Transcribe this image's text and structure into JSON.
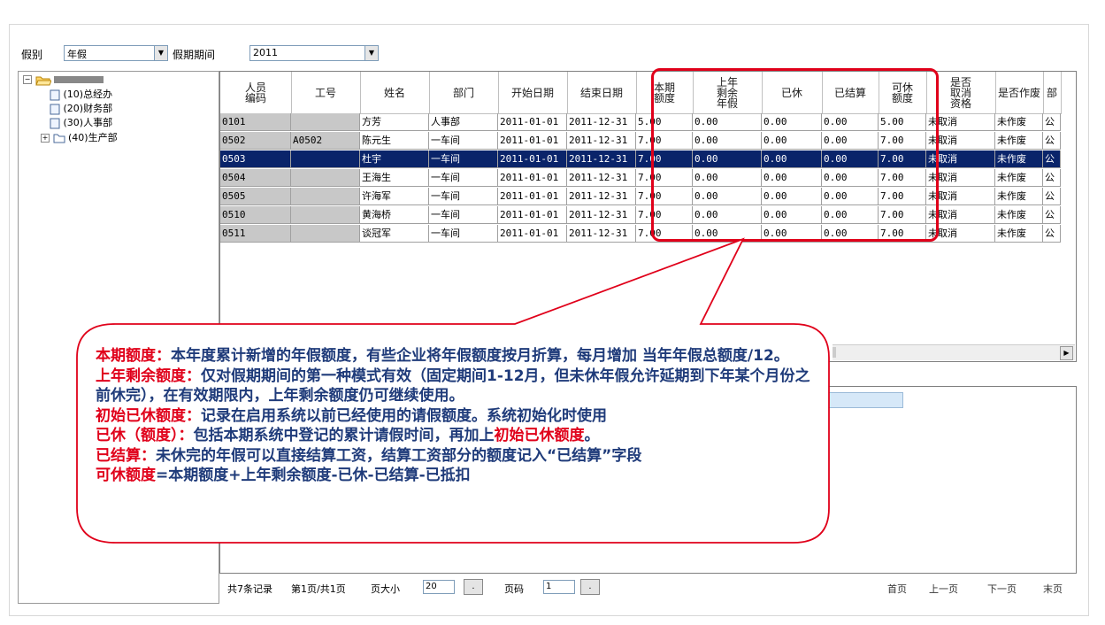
{
  "filters": {
    "leave_type_label": "假别",
    "leave_type_value": "年假",
    "period_label": "假期期间",
    "period_value": "2011"
  },
  "tree": {
    "root": "",
    "items": [
      {
        "label": "(10)总经办"
      },
      {
        "label": "(20)财务部"
      },
      {
        "label": "(30)人事部"
      },
      {
        "label": "(40)生产部"
      }
    ]
  },
  "grid": {
    "columns": [
      "人员编码",
      "工号",
      "姓名",
      "部门",
      "开始日期",
      "结束日期",
      "本期额度",
      "上年剩余年假",
      "已休",
      "已结算",
      "可休额度",
      "是否取消资格",
      "是否作废",
      "部"
    ],
    "rows": [
      [
        "0101",
        "",
        "方芳",
        "人事部",
        "2011-01-01",
        "2011-12-31",
        "5.00",
        "0.00",
        "0.00",
        "0.00",
        "5.00",
        "未取消",
        "未作废",
        "公"
      ],
      [
        "0502",
        "A0502",
        "陈元生",
        "一车间",
        "2011-01-01",
        "2011-12-31",
        "7.00",
        "0.00",
        "0.00",
        "0.00",
        "7.00",
        "未取消",
        "未作废",
        "公"
      ],
      [
        "0503",
        "",
        "杜宇",
        "一车间",
        "2011-01-01",
        "2011-12-31",
        "7.00",
        "0.00",
        "0.00",
        "0.00",
        "7.00",
        "未取消",
        "未作废",
        "公"
      ],
      [
        "0504",
        "",
        "王海生",
        "一车间",
        "2011-01-01",
        "2011-12-31",
        "7.00",
        "0.00",
        "0.00",
        "0.00",
        "7.00",
        "未取消",
        "未作废",
        "公"
      ],
      [
        "0505",
        "",
        "许海军",
        "一车间",
        "2011-01-01",
        "2011-12-31",
        "7.00",
        "0.00",
        "0.00",
        "0.00",
        "7.00",
        "未取消",
        "未作废",
        "公"
      ],
      [
        "0510",
        "",
        "黄海桥",
        "一车间",
        "2011-01-01",
        "2011-12-31",
        "7.00",
        "0.00",
        "0.00",
        "0.00",
        "7.00",
        "未取消",
        "未作废",
        "公"
      ],
      [
        "0511",
        "",
        "谈冠军",
        "一车间",
        "2011-01-01",
        "2011-12-31",
        "7.00",
        "0.00",
        "0.00",
        "0.00",
        "7.00",
        "未取消",
        "未作废",
        "公"
      ]
    ]
  },
  "pager": {
    "summary": "共7条记录",
    "page_info": "第1页/共1页",
    "page_size_label": "页大小",
    "page_size_value": "20",
    "page_no_label": "页码",
    "page_no_value": "1",
    "go_label": ".",
    "first": "首页",
    "prev": "上一页",
    "next": "下一页",
    "last": "末页"
  },
  "annotation": {
    "lines": [
      {
        "key": "本期额度：",
        "text": "本年度累计新增的年假额度，有些企业将年假额度按月折算，每月增加 当年年假总额度/12。"
      },
      {
        "key": "上年剩余额度：",
        "text": "仅对假期期间的第一种模式有效（固定期间1-12月，但未休年假允许延期到下年某个月份之前休完），在有效期限内，上年剩余额度仍可继续使用。"
      },
      {
        "key": "初始已休额度：",
        "text": "记录在启用系统以前已经使用的请假额度。系统初始化时使用"
      },
      {
        "key": "已休（额度）：",
        "text": "包括本期系统中登记的累计请假时间，再加上",
        "key2": "初始已休额度",
        "tail": "。"
      },
      {
        "key": "已结算：",
        "text": "未休完的年假可以直接结算工资，结算工资部分的额度记入“已结算”字段"
      },
      {
        "key": "可休额度",
        "text": "=本期额度+上年剩余额度-已休-已结算-已抵扣"
      }
    ]
  },
  "colors": {
    "accent_red": "#e0001a",
    "note_blue": "#1f3b7a",
    "selected_row": "#0a246a"
  }
}
